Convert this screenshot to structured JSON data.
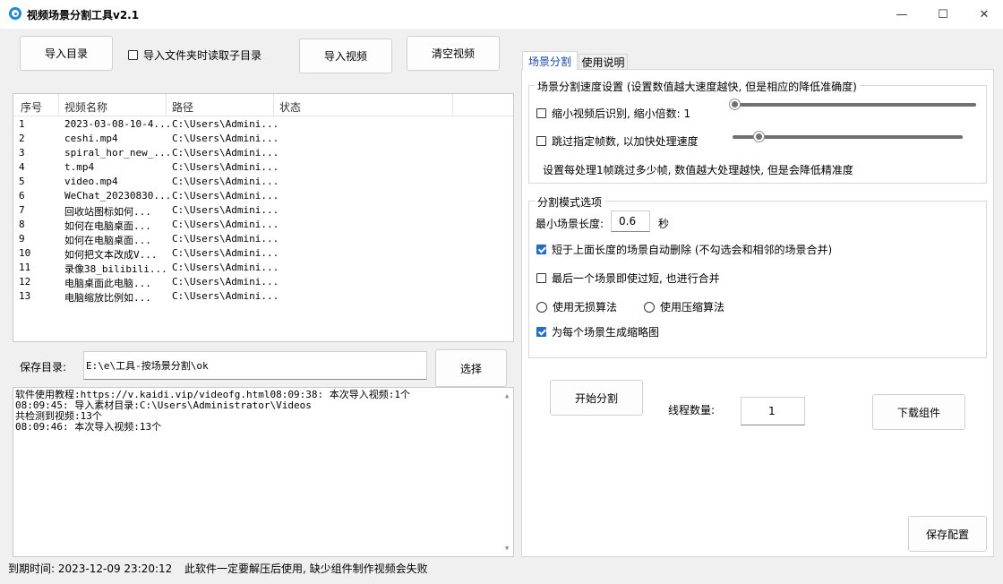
{
  "window": {
    "title": "视频场景分割工具v2.1",
    "minimize": "—",
    "maximize": "☐",
    "close": "✕"
  },
  "toolbar": {
    "import_dir": "导入目录",
    "read_subdirs": "导入文件夹时读取子目录",
    "import_video": "导入视频",
    "clear_video": "清空视频"
  },
  "list": {
    "columns": [
      "序号",
      "视频名称",
      "路径",
      "状态"
    ],
    "rows": [
      {
        "no": "1",
        "name": "2023-03-08-10-4...",
        "path": "C:\\Users\\Admini..."
      },
      {
        "no": "2",
        "name": "ceshi.mp4",
        "path": "C:\\Users\\Admini..."
      },
      {
        "no": "3",
        "name": "spiral_hor_new_...",
        "path": "C:\\Users\\Admini..."
      },
      {
        "no": "4",
        "name": "t.mp4",
        "path": "C:\\Users\\Admini..."
      },
      {
        "no": "5",
        "name": "video.mp4",
        "path": "C:\\Users\\Admini..."
      },
      {
        "no": "6",
        "name": "WeChat_20230830...",
        "path": "C:\\Users\\Admini..."
      },
      {
        "no": "7",
        "name": "回收站图标如何...",
        "path": "C:\\Users\\Admini..."
      },
      {
        "no": "8",
        "name": "如何在电脑桌面...",
        "path": "C:\\Users\\Admini..."
      },
      {
        "no": "9",
        "name": "如何在电脑桌面...",
        "path": "C:\\Users\\Admini..."
      },
      {
        "no": "10",
        "name": "如何把文本改成V...",
        "path": "C:\\Users\\Admini..."
      },
      {
        "no": "11",
        "name": "录像38_bilibili...",
        "path": "C:\\Users\\Admini..."
      },
      {
        "no": "12",
        "name": "电脑桌面此电脑...",
        "path": "C:\\Users\\Admini..."
      },
      {
        "no": "13",
        "name": "电脑缩放比例如...",
        "path": "C:\\Users\\Admini..."
      }
    ]
  },
  "save": {
    "label": "保存目录:",
    "value": "E:\\e\\工具-按场景分割\\ok",
    "choose": "选择"
  },
  "log": [
    "软件使用教程:https://v.kaidi.vip/videofg.html08:09:38: 本次导入视频:1个",
    "08:09:45: 导入素材目录:C:\\Users\\Administrator\\Videos",
    "共检测到视频:13个",
    "08:09:46: 本次导入视频:13个"
  ],
  "tabs": {
    "scene": "场景分割",
    "help": "使用说明"
  },
  "speed": {
    "legend": "场景分割速度设置 (设置数值越大速度越快, 但是相应的降低准确度)",
    "shrink": "缩小视频后识别, 缩小倍数: 1",
    "skip": "跳过指定帧数, 以加快处理速度",
    "hint": "设置每处理1帧跳过多少帧, 数值越大处理越快, 但是会降低精准度"
  },
  "mode": {
    "legend": "分割模式选项",
    "min_len_label": "最小场景长度:",
    "min_len_value": "0.6",
    "unit": "秒",
    "auto_delete": "短于上面长度的场景自动删除 (不勾选会和相邻的场景合并)",
    "merge_last": "最后一个场景即使过短, 也进行合并",
    "lossless": "使用无损算法",
    "compress": "使用压缩算法",
    "thumbnail": "为每个场景生成缩略图"
  },
  "actions": {
    "start": "开始分割",
    "threads_label": "线程数量:",
    "threads_value": "1",
    "download": "下载组件",
    "save_config": "保存配置"
  },
  "status": {
    "expire": "到期时间: 2023-12-09 23:20:12",
    "notice": "此软件一定要解压后使用, 缺少组件制作视频会失败"
  },
  "colors": {
    "accent": "#1e6fd0",
    "tab_active": "#1a47b8"
  }
}
